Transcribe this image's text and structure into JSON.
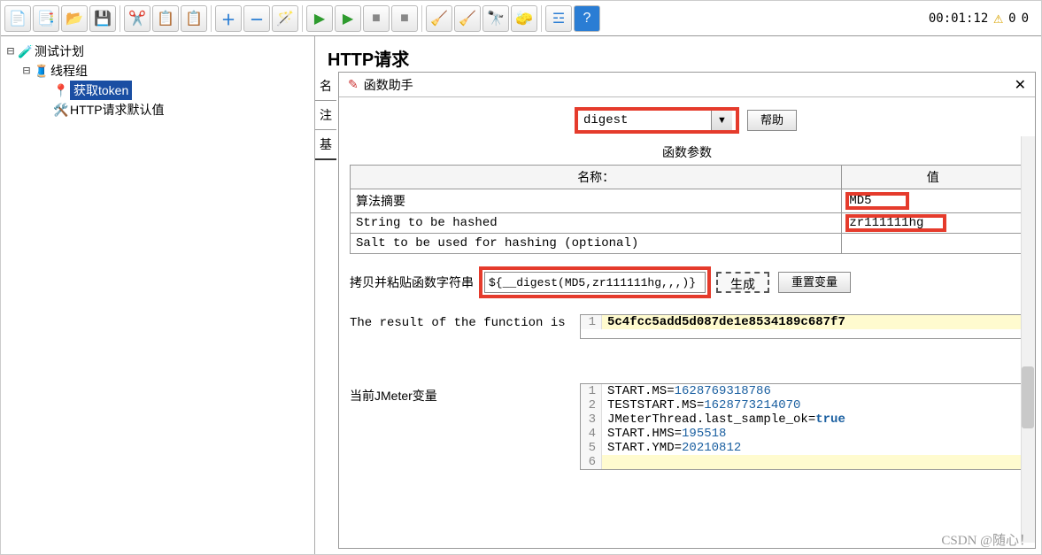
{
  "toolbar": {
    "timer": "00:01:12",
    "warn_count1": "0",
    "warn_count2": "0"
  },
  "tree": {
    "root": "测试计划",
    "thread_group": "线程组",
    "node_token": "获取token",
    "node_defaults": "HTTP请求默认值"
  },
  "page": {
    "title": "HTTP请求",
    "label_name": "名",
    "label_note": "注",
    "label_base": "基"
  },
  "dialog": {
    "title": "函数助手",
    "combo_value": "digest",
    "help_btn": "帮助",
    "params_title": "函数参数",
    "col_name": "名称：",
    "col_value": "值",
    "rows": [
      {
        "name": "算法摘要",
        "value": "MD5"
      },
      {
        "name": "String to be hashed",
        "value": "zr111111hg"
      },
      {
        "name": "Salt to be used for hashing (optional)",
        "value": ""
      }
    ],
    "copy_label": "拷贝并粘贴函数字符串",
    "fn_string": "${__digest(MD5,zr111111hg,,,)}",
    "gen_btn": "生成",
    "reset_btn": "重置变量",
    "result_label": "The result of the function is",
    "result_value": "5c4fcc5add5d087de1e8534189c687f7",
    "vars_label": "当前JMeter变量",
    "vars": [
      {
        "k": "START.MS",
        "v": "1628769318786"
      },
      {
        "k": "TESTSTART.MS",
        "v": "1628773214070"
      },
      {
        "k": "JMeterThread.last_sample_ok",
        "v": "true",
        "bool": true
      },
      {
        "k": "START.HMS",
        "v": "195518"
      },
      {
        "k": "START.YMD",
        "v": "20210812"
      }
    ]
  },
  "watermark": "CSDN @随心！"
}
